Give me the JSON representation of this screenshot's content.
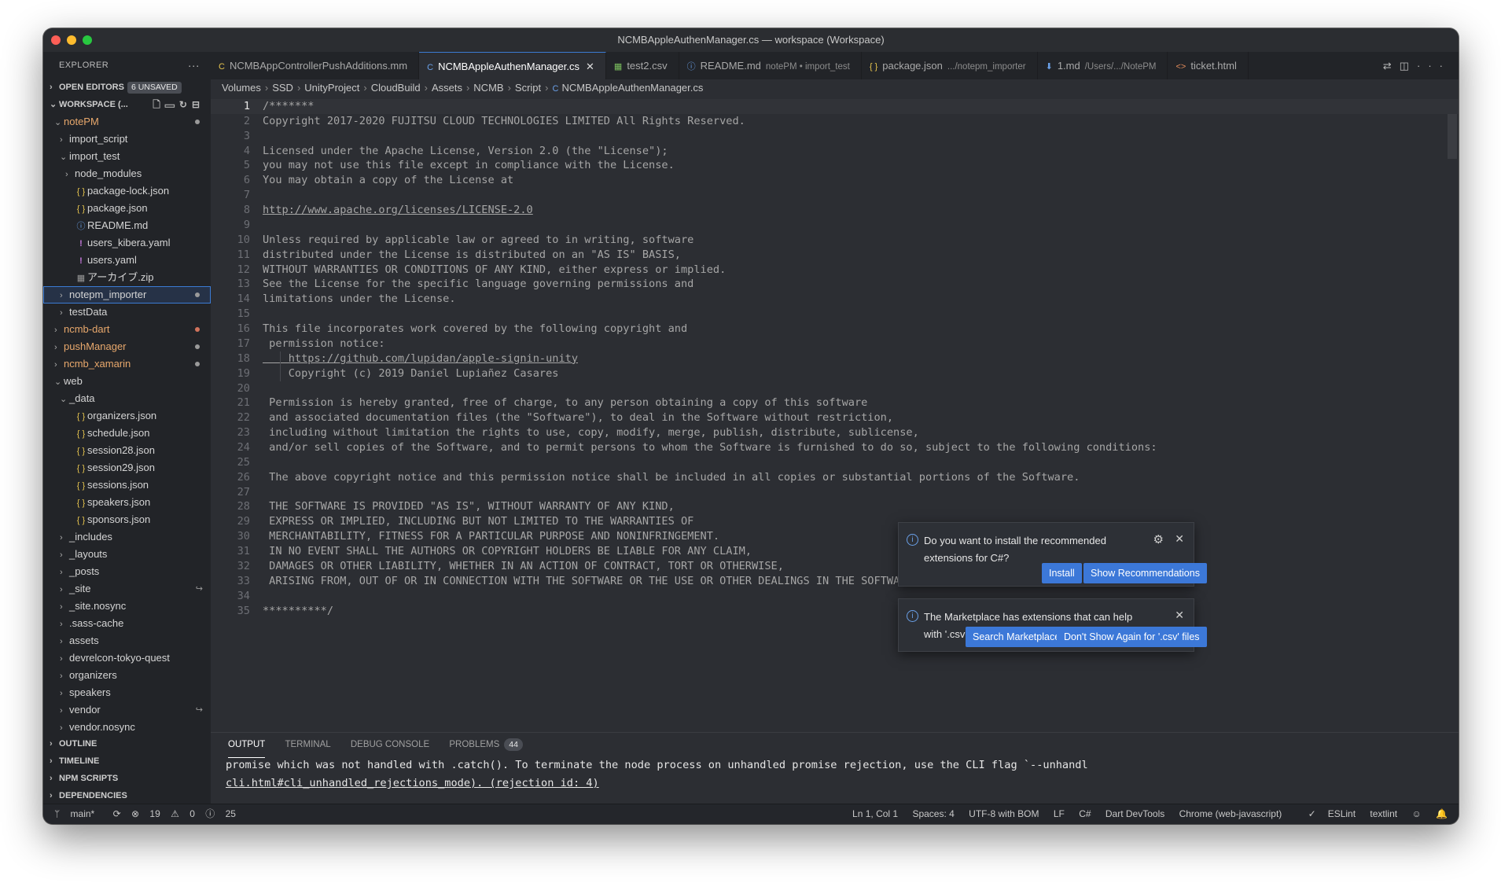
{
  "window": {
    "title": "NCMBAppleAuthenManager.cs — workspace (Workspace)"
  },
  "explorer": {
    "header": "EXPLORER",
    "open_editors": "OPEN EDITORS",
    "unsaved": "6 UNSAVED",
    "workspace": "WORKSPACE (...",
    "tree": [
      {
        "label": "notePM",
        "depth": 0,
        "chev": "⌄",
        "icon": "",
        "cls": "orange",
        "dot": "grey"
      },
      {
        "label": "import_script",
        "depth": 1,
        "chev": "›",
        "icon": ""
      },
      {
        "label": "import_test",
        "depth": 1,
        "chev": "⌄",
        "icon": ""
      },
      {
        "label": "node_modules",
        "depth": 2,
        "chev": "›",
        "icon": ""
      },
      {
        "label": "package-lock.json",
        "depth": 2,
        "chev": "",
        "icon": "{ }",
        "iconcls": "j"
      },
      {
        "label": "package.json",
        "depth": 2,
        "chev": "",
        "icon": "{ }",
        "iconcls": "j"
      },
      {
        "label": "README.md",
        "depth": 2,
        "chev": "",
        "icon": "ⓘ",
        "iconcls": "info"
      },
      {
        "label": "users_kibera.yaml",
        "depth": 2,
        "chev": "",
        "icon": "!",
        "iconcls": "excl"
      },
      {
        "label": "users.yaml",
        "depth": 2,
        "chev": "",
        "icon": "!",
        "iconcls": "excl"
      },
      {
        "label": "アーカイブ.zip",
        "depth": 2,
        "chev": "",
        "icon": "▦",
        "iconcls": "zip"
      },
      {
        "label": "notepm_importer",
        "depth": 1,
        "chev": "›",
        "icon": "",
        "selected": true,
        "dot": "grey"
      },
      {
        "label": "testData",
        "depth": 1,
        "chev": "›",
        "icon": ""
      },
      {
        "label": "ncmb-dart",
        "depth": 0,
        "chev": "›",
        "icon": "",
        "cls": "orange",
        "dot": "red"
      },
      {
        "label": "pushManager",
        "depth": 0,
        "chev": "›",
        "icon": "",
        "cls": "orange",
        "dot": "grey"
      },
      {
        "label": "ncmb_xamarin",
        "depth": 0,
        "chev": "›",
        "icon": "",
        "cls": "orange",
        "dot": "grey"
      },
      {
        "label": "web",
        "depth": 0,
        "chev": "⌄",
        "icon": ""
      },
      {
        "label": "_data",
        "depth": 1,
        "chev": "⌄",
        "icon": ""
      },
      {
        "label": "organizers.json",
        "depth": 2,
        "chev": "",
        "icon": "{ }",
        "iconcls": "j"
      },
      {
        "label": "schedule.json",
        "depth": 2,
        "chev": "",
        "icon": "{ }",
        "iconcls": "j"
      },
      {
        "label": "session28.json",
        "depth": 2,
        "chev": "",
        "icon": "{ }",
        "iconcls": "j"
      },
      {
        "label": "session29.json",
        "depth": 2,
        "chev": "",
        "icon": "{ }",
        "iconcls": "j"
      },
      {
        "label": "sessions.json",
        "depth": 2,
        "chev": "",
        "icon": "{ }",
        "iconcls": "j"
      },
      {
        "label": "speakers.json",
        "depth": 2,
        "chev": "",
        "icon": "{ }",
        "iconcls": "j"
      },
      {
        "label": "sponsors.json",
        "depth": 2,
        "chev": "",
        "icon": "{ }",
        "iconcls": "j"
      },
      {
        "label": "_includes",
        "depth": 1,
        "chev": "›",
        "icon": ""
      },
      {
        "label": "_layouts",
        "depth": 1,
        "chev": "›",
        "icon": ""
      },
      {
        "label": "_posts",
        "depth": 1,
        "chev": "›",
        "icon": ""
      },
      {
        "label": "_site",
        "depth": 1,
        "chev": "›",
        "icon": "",
        "link": true
      },
      {
        "label": "_site.nosync",
        "depth": 1,
        "chev": "›",
        "icon": ""
      },
      {
        "label": ".sass-cache",
        "depth": 1,
        "chev": "›",
        "icon": ""
      },
      {
        "label": "assets",
        "depth": 1,
        "chev": "›",
        "icon": ""
      },
      {
        "label": "devrelcon-tokyo-quest",
        "depth": 1,
        "chev": "›",
        "icon": ""
      },
      {
        "label": "organizers",
        "depth": 1,
        "chev": "›",
        "icon": ""
      },
      {
        "label": "speakers",
        "depth": 1,
        "chev": "›",
        "icon": ""
      },
      {
        "label": "vendor",
        "depth": 1,
        "chev": "›",
        "icon": "",
        "link": true
      },
      {
        "label": "vendor.nosync",
        "depth": 1,
        "chev": "›",
        "icon": ""
      }
    ],
    "bottom_sections": [
      "OUTLINE",
      "TIMELINE",
      "NPM SCRIPTS",
      "DEPENDENCIES"
    ]
  },
  "tabs": [
    {
      "label": "NCMBAppControllerPushAdditions.mm",
      "icon": "C",
      "iconColor": "#e6c44e",
      "sub": ""
    },
    {
      "label": "NCMBAppleAuthenManager.cs",
      "icon": "C",
      "iconColor": "#6aa0e8",
      "sub": "",
      "active": true
    },
    {
      "label": "test2.csv",
      "icon": "▦",
      "iconColor": "#7bbf5e",
      "sub": ""
    },
    {
      "label": "README.md",
      "icon": "ⓘ",
      "iconColor": "#6aa0e8",
      "sub": "notePM • import_test"
    },
    {
      "label": "package.json",
      "icon": "{ }",
      "iconColor": "#e6c44e",
      "sub": ".../notepm_importer"
    },
    {
      "label": "1.md",
      "icon": "⬇",
      "iconColor": "#6aa0e8",
      "sub": "/Users/.../NotePM"
    },
    {
      "label": "ticket.html",
      "icon": "<>",
      "iconColor": "#e08a5a",
      "sub": ""
    }
  ],
  "breadcrumb": [
    "Volumes",
    "SSD",
    "UnityProject",
    "CloudBuild",
    "Assets",
    "NCMB",
    "Script",
    "NCMBAppleAuthenManager.cs"
  ],
  "code": [
    {
      "n": "1",
      "t": "/*******"
    },
    {
      "n": "2",
      "t": "Copyright 2017-2020 FUJITSU CLOUD TECHNOLOGIES LIMITED All Rights Reserved."
    },
    {
      "n": "3",
      "t": ""
    },
    {
      "n": "4",
      "t": "Licensed under the Apache License, Version 2.0 (the \"License\");"
    },
    {
      "n": "5",
      "t": "you may not use this file except in compliance with the License."
    },
    {
      "n": "6",
      "t": "You may obtain a copy of the License at"
    },
    {
      "n": "7",
      "t": ""
    },
    {
      "n": "8",
      "t": "http://www.apache.org/licenses/LICENSE-2.0",
      "link": true
    },
    {
      "n": "9",
      "t": ""
    },
    {
      "n": "10",
      "t": "Unless required by applicable law or agreed to in writing, software"
    },
    {
      "n": "11",
      "t": "distributed under the License is distributed on an \"AS IS\" BASIS,"
    },
    {
      "n": "12",
      "t": "WITHOUT WARRANTIES OR CONDITIONS OF ANY KIND, either express or implied."
    },
    {
      "n": "13",
      "t": "See the License for the specific language governing permissions and"
    },
    {
      "n": "14",
      "t": "limitations under the License."
    },
    {
      "n": "15",
      "t": ""
    },
    {
      "n": "16",
      "t": "This file incorporates work covered by the following copyright and"
    },
    {
      "n": "17",
      "t": " permission notice:"
    },
    {
      "n": "18",
      "t": "    https://github.com/lupidan/apple-signin-unity",
      "link": true
    },
    {
      "n": "19",
      "t": "    Copyright (c) 2019 Daniel Lupiañez Casares"
    },
    {
      "n": "20",
      "t": ""
    },
    {
      "n": "21",
      "t": " Permission is hereby granted, free of charge, to any person obtaining a copy of this software"
    },
    {
      "n": "22",
      "t": " and associated documentation files (the \"Software\"), to deal in the Software without restriction,"
    },
    {
      "n": "23",
      "t": " including without limitation the rights to use, copy, modify, merge, publish, distribute, sublicense,"
    },
    {
      "n": "24",
      "t": " and/or sell copies of the Software, and to permit persons to whom the Software is furnished to do so, subject to the following conditions:"
    },
    {
      "n": "25",
      "t": ""
    },
    {
      "n": "26",
      "t": " The above copyright notice and this permission notice shall be included in all copies or substantial portions of the Software."
    },
    {
      "n": "27",
      "t": ""
    },
    {
      "n": "28",
      "t": " THE SOFTWARE IS PROVIDED \"AS IS\", WITHOUT WARRANTY OF ANY KIND,"
    },
    {
      "n": "29",
      "t": " EXPRESS OR IMPLIED, INCLUDING BUT NOT LIMITED TO THE WARRANTIES OF"
    },
    {
      "n": "30",
      "t": " MERCHANTABILITY, FITNESS FOR A PARTICULAR PURPOSE AND NONINFRINGEMENT."
    },
    {
      "n": "31",
      "t": " IN NO EVENT SHALL THE AUTHORS OR COPYRIGHT HOLDERS BE LIABLE FOR ANY CLAIM,"
    },
    {
      "n": "32",
      "t": " DAMAGES OR OTHER LIABILITY, WHETHER IN AN ACTION OF CONTRACT, TORT OR OTHERWISE,"
    },
    {
      "n": "33",
      "t": " ARISING FROM, OUT OF OR IN CONNECTION WITH THE SOFTWARE OR THE USE OR OTHER DEALINGS IN THE SOFTWARE."
    },
    {
      "n": "34",
      "t": ""
    },
    {
      "n": "35",
      "t": "**********/"
    }
  ],
  "panel": {
    "tabs": [
      "OUTPUT",
      "TERMINAL",
      "DEBUG CONSOLE",
      "PROBLEMS"
    ],
    "problems_count": "44",
    "output_lines": [
      "promise which was not handled with .catch(). To terminate the node process on unhandled promise rejection, use the CLI flag `--unhandl",
      "cli.html#cli_unhandled_rejections_mode). (rejection id: 4)"
    ]
  },
  "status": {
    "branch": "main*",
    "sync": "⟳",
    "errors": "19",
    "warnings": "0",
    "infos": "25",
    "position": "Ln 1, Col 1",
    "spaces": "Spaces: 4",
    "encoding": "UTF-8 with BOM",
    "eol": "LF",
    "language": "C#",
    "dart": "Dart DevTools",
    "chrome": "Chrome (web-javascript)",
    "eslint": "ESLint",
    "textlint": "textlint"
  },
  "notifications": {
    "n1": {
      "message": "Do you want to install the recommended extensions for C#?",
      "install": "Install",
      "show": "Show Recommendations"
    },
    "n2": {
      "message": "The Marketplace has extensions that can help with '.csv' files",
      "search": "Search Marketplace",
      "dont": "Don't Show Again for '.csv' files"
    }
  },
  "colors": {
    "accent": "#3c78d8",
    "modified": "#e8a86c",
    "bg": "#2c2e33"
  }
}
